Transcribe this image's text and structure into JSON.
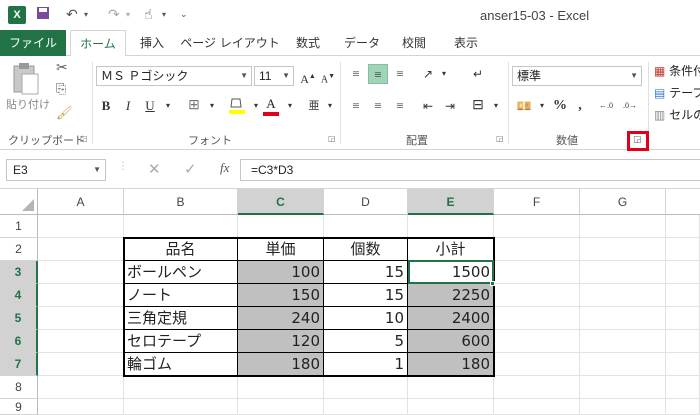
{
  "window": {
    "title": "anser15-03 - Excel",
    "logo": "X"
  },
  "tabs": [
    {
      "label": "ファイル"
    },
    {
      "label": "ホーム"
    },
    {
      "label": "挿入"
    },
    {
      "label": "ページ レイアウト"
    },
    {
      "label": "数式"
    },
    {
      "label": "データ"
    },
    {
      "label": "校閲"
    },
    {
      "label": "表示"
    }
  ],
  "ribbon": {
    "clipboard": {
      "label": "クリップボード",
      "paste_label": "貼り付け"
    },
    "font": {
      "label": "フォント",
      "font_name": "ＭＳ Ｐゴシック",
      "font_size": "11"
    },
    "alignment": {
      "label": "配置"
    },
    "number": {
      "label": "数値",
      "format": "標準"
    },
    "styles": {
      "conditional": "条件付",
      "table": "テーブ",
      "cell": "セルの"
    }
  },
  "formula_bar": {
    "name_box": "E3",
    "formula": "=C3*D3",
    "fx": "fx"
  },
  "columns": [
    "A",
    "B",
    "C",
    "D",
    "E",
    "F",
    "G"
  ],
  "rows": [
    "1",
    "2",
    "3",
    "4",
    "5",
    "6",
    "7",
    "8",
    "9"
  ],
  "table": {
    "headers": [
      "品名",
      "単価",
      "個数",
      "小計"
    ],
    "rows": [
      [
        "ボールペン",
        "100",
        "15",
        "1500"
      ],
      [
        "ノート",
        "150",
        "15",
        "2250"
      ],
      [
        "三角定規",
        "240",
        "10",
        "2400"
      ],
      [
        "セロテープ",
        "120",
        "5",
        "600"
      ],
      [
        "輪ゴム",
        "180",
        "1",
        "180"
      ]
    ]
  },
  "colors": {
    "accent": "#217346",
    "highlight": "#e0001a",
    "gray_fill": "#c0c0c0"
  }
}
